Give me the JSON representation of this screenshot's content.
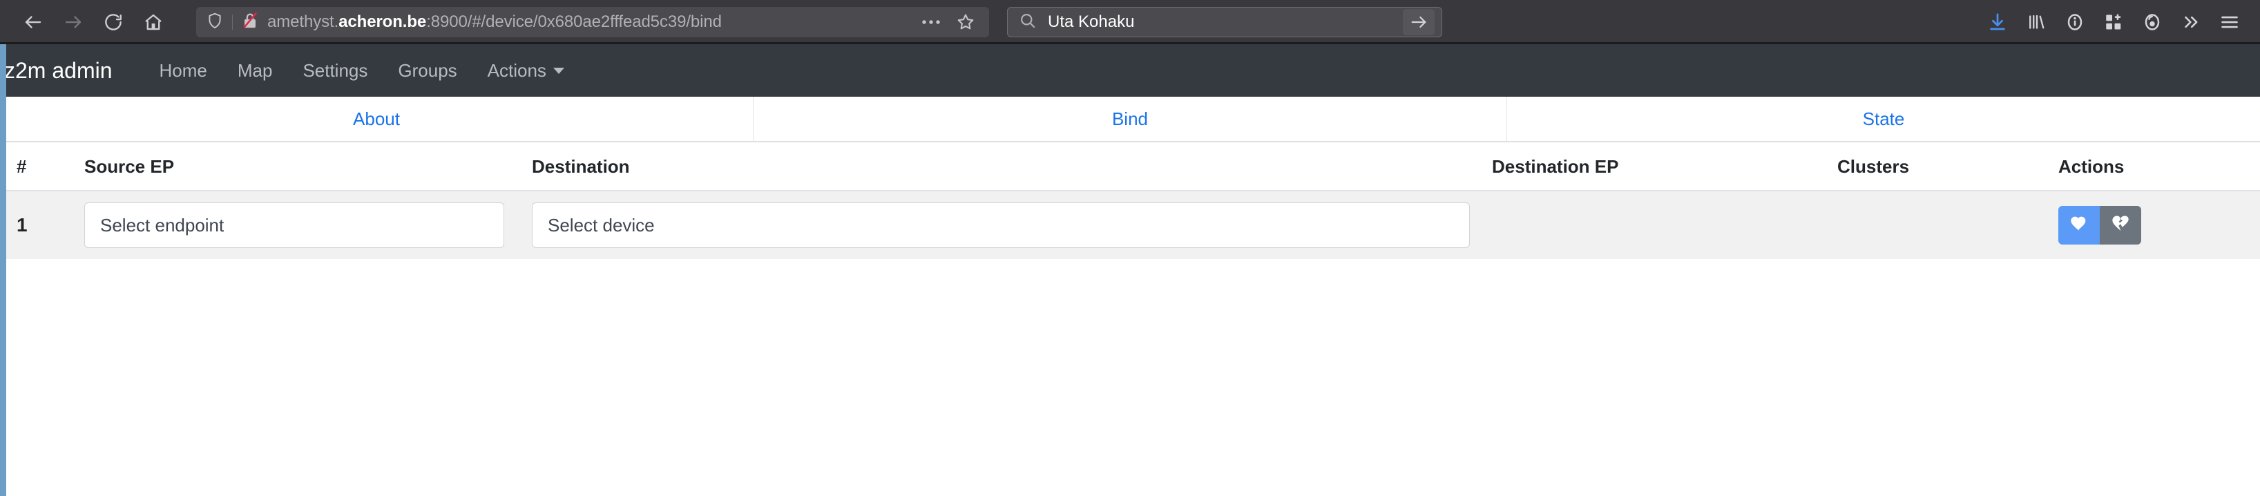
{
  "browser": {
    "nav": {
      "back_icon": "arrow-left-icon",
      "forward_icon": "arrow-right-icon",
      "reload_icon": "reload-icon",
      "home_icon": "home-icon"
    },
    "urlbar": {
      "shield_icon": "shield-icon",
      "lock_icon": "lock-crossed-out-icon",
      "url_prefix": "amethyst.",
      "url_host": "acheron.be",
      "url_suffix": ":8900/#/device/0x680ae2fffead5c39/bind",
      "page_actions_icon": "ellipsis-icon",
      "bookmark_icon": "star-icon"
    },
    "search": {
      "icon": "search-icon",
      "value": "Uta Kohaku",
      "go_icon": "arrow-right-icon"
    },
    "toolbar_icons": [
      "download-icon",
      "library-icon",
      "pocket-info-icon",
      "extensions-icon",
      "account-avatar-icon",
      "chevron-double-right-icon",
      "hamburger-menu-icon"
    ],
    "accent_colors": {
      "download_blue": "#4a90f0",
      "lock_slash_red": "#e8254b"
    }
  },
  "app": {
    "brand": "z2m admin",
    "navlinks": [
      {
        "label": "Home"
      },
      {
        "label": "Map"
      },
      {
        "label": "Settings"
      },
      {
        "label": "Groups"
      },
      {
        "label": "Actions",
        "has_caret": true
      }
    ],
    "tabs": [
      {
        "label": "About"
      },
      {
        "label": "Bind"
      },
      {
        "label": "State"
      }
    ],
    "tab_link_color": "#1a73e8",
    "navbar_color": "#343a40"
  },
  "table": {
    "headers": {
      "num": "#",
      "source_ep": "Source EP",
      "destination": "Destination",
      "destination_ep": "Destination EP",
      "clusters": "Clusters",
      "actions": "Actions"
    },
    "rows": [
      {
        "index": "1",
        "source_ep_placeholder": "Select endpoint",
        "destination_placeholder": "Select device",
        "destination_ep": "",
        "clusters": "",
        "bind_icon": "heart-icon",
        "unbind_icon": "heart-broken-icon"
      }
    ],
    "button_colors": {
      "bind": "#5b9bf7",
      "unbind": "#6c757d"
    }
  }
}
